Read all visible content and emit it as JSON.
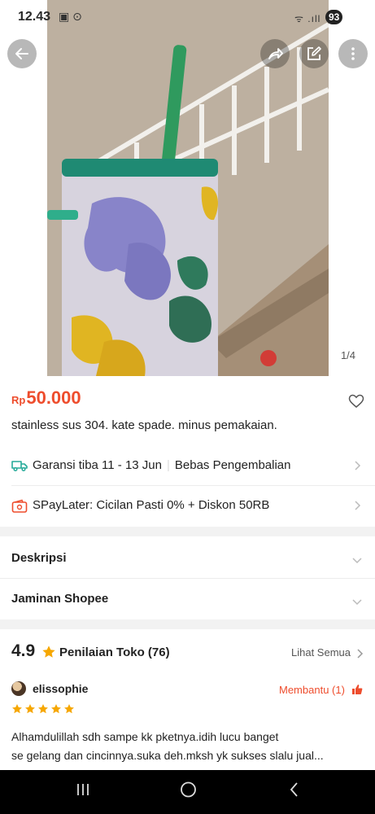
{
  "status_bar": {
    "time": "12.43",
    "status_icons": "▣ ⊙",
    "network": "ᯤ .ıll",
    "battery": "93"
  },
  "gallery": {
    "page_indicator": "1/4"
  },
  "product": {
    "currency": "Rp",
    "price": "50.000",
    "title": "stainless sus 304. kate spade. minus pemakaian."
  },
  "shipping": {
    "guarantee": "Garansi tiba 11 - 13 Jun",
    "returns": "Bebas Pengembalian"
  },
  "paylater": {
    "text": "SPayLater: Cicilan Pasti 0% + Diskon 50RB"
  },
  "sections": {
    "description": "Deskripsi",
    "guarantee": "Jaminan Shopee"
  },
  "reviews": {
    "rating": "4.9",
    "label": "Penilaian Toko (76)",
    "see_all": "Lihat Semua",
    "items": [
      {
        "user": "elissophie",
        "helpful": "Membantu (1)",
        "stars": 5,
        "line1": "Alhamdulillah sdh sampe kk pketnya.idih lucu banget",
        "line2": "se gelang dan cincinnya.suka deh.mksh yk sukses slalu jual..."
      }
    ]
  },
  "colors": {
    "accent": "#ee4d2d",
    "star": "#f6a700",
    "green": "#26aa99"
  }
}
